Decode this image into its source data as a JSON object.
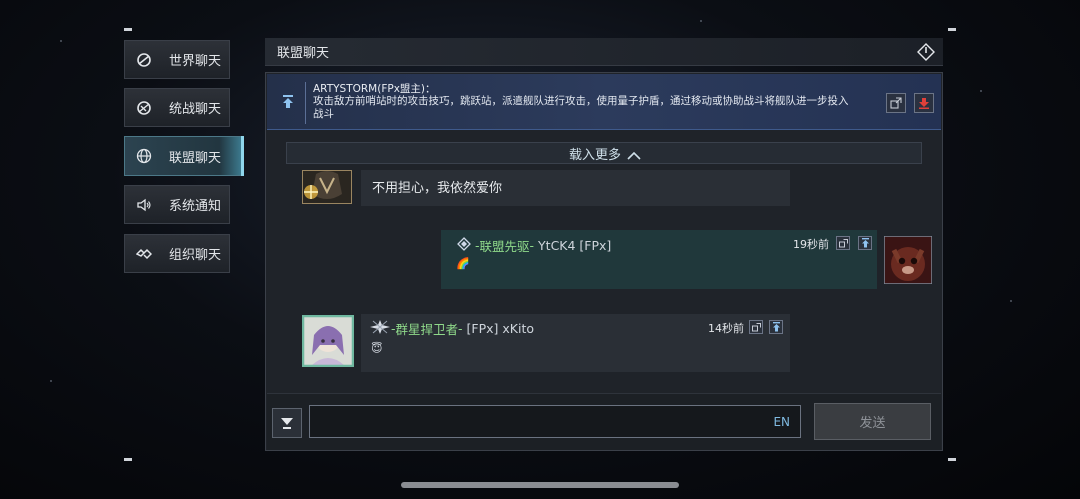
{
  "nav": {
    "items": [
      {
        "label": "世界聊天",
        "icon": "world-chat-icon"
      },
      {
        "label": "统战聊天",
        "icon": "united-chat-icon"
      },
      {
        "label": "联盟聊天",
        "icon": "globe-icon"
      },
      {
        "label": "系统通知",
        "icon": "speaker-icon"
      },
      {
        "label": "组织聊天",
        "icon": "org-chat-icon"
      }
    ],
    "active": 2
  },
  "panel": {
    "title": "联盟聊天",
    "close_icon": "close-icon"
  },
  "pinned": {
    "author": "ARTYSTORM(FPx盟主)：",
    "text": "攻击敌方前哨站时的攻击技巧，跳跃站，派遣舰队进行攻击，使用量子护盾，通过移动或协助战斗将舰队进一步投入战斗"
  },
  "load_more": "载入更多",
  "messages": [
    {
      "text": "不用担心，我依然爱你"
    },
    {
      "prefix": "-",
      "name": "联盟先驱",
      "suffix": "-",
      "tag": "YtCK4 [FPx]",
      "time": "19秒前",
      "emoji": "🌈"
    },
    {
      "prefix": "-",
      "name": "群星捍卫者",
      "suffix": "-",
      "tag": "[FPx] xKito",
      "time": "14秒前",
      "emoji": "😇"
    }
  ],
  "input": {
    "value": "",
    "lang": "EN",
    "send_label": "发送"
  },
  "colors": {
    "accent": "#8fd6ec",
    "name_green": "#8fd98a",
    "pinned_bg": "#2c3b5c",
    "download_red": "#e0403a"
  }
}
